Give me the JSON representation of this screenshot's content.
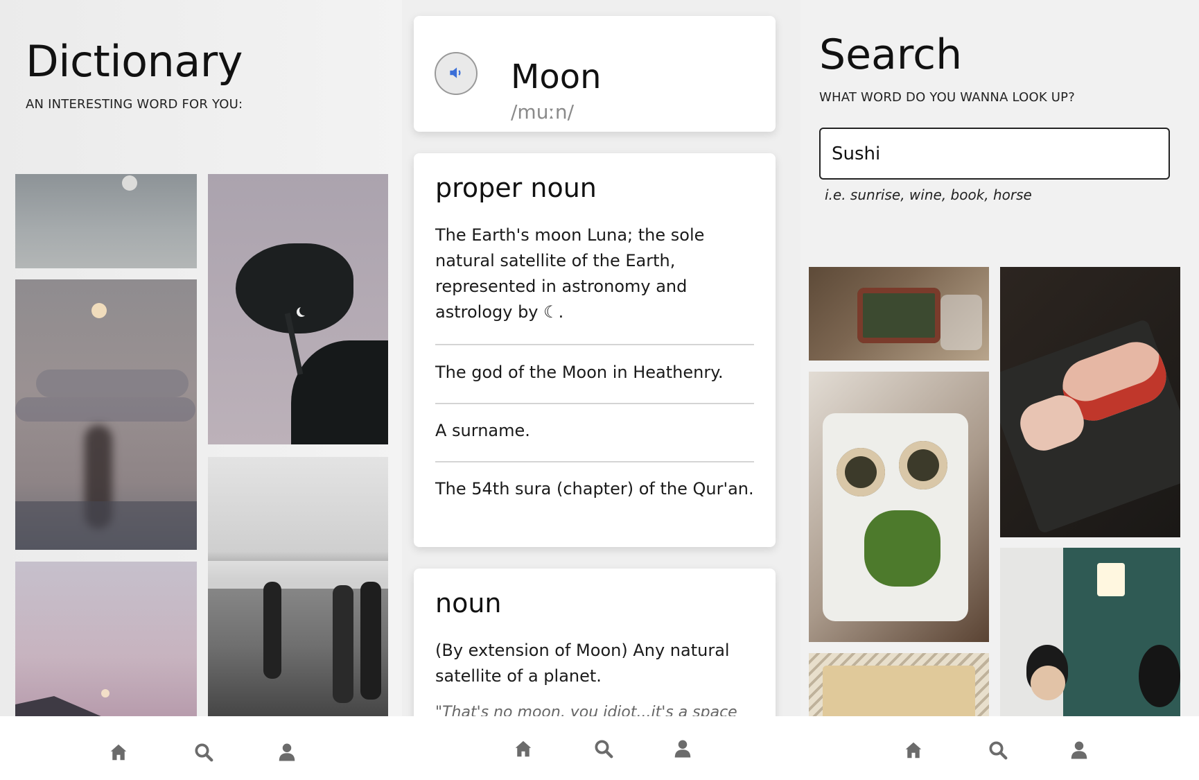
{
  "left": {
    "title": "Dictionary",
    "subtitle": "AN INTERESTING WORD FOR YOU:"
  },
  "middle": {
    "word": "Moon",
    "phonetic": "/muːn/",
    "meanings": [
      {
        "part_of_speech": "proper noun",
        "definitions": [
          "The Earth's moon Luna; the sole natural satellite of the Earth, represented in astronomy and astrology by ☾.",
          "The god of the Moon in Heathenry.",
          "A surname.",
          "The 54th sura (chapter) of the Qur'an."
        ]
      },
      {
        "part_of_speech": "noun",
        "definitions": [
          "(By extension of Moon) Any natural satellite of a planet."
        ],
        "example": "\"That's no moon, you idiot...it's a space"
      }
    ]
  },
  "right": {
    "title": "Search",
    "subtitle": "WHAT WORD DO YOU WANNA LOOK UP?",
    "search_value": "Sushi",
    "hint": "i.e. sunrise, wine, book, horse"
  },
  "nav": {
    "icons": [
      "home-icon",
      "search-icon",
      "user-icon"
    ]
  },
  "colors": {
    "accent": "#3b6fd8",
    "nav_icon": "#6b6b6b",
    "background": "#efefef"
  }
}
